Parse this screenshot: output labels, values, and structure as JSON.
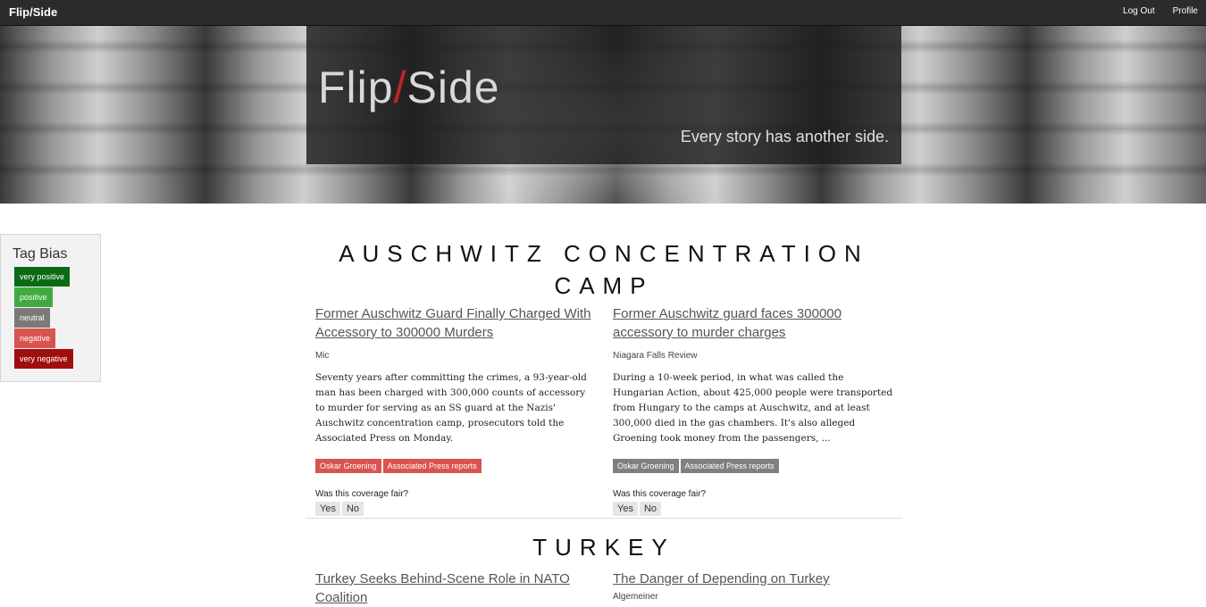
{
  "nav": {
    "brand": "Flip/Side",
    "logout": "Log Out",
    "profile": "Profile"
  },
  "hero": {
    "title_left": "Flip",
    "title_slash": "/",
    "title_right": "Side",
    "tagline": "Every story has another side."
  },
  "tag_bias": {
    "title": "Tag Bias",
    "levels": [
      {
        "label": "very positive",
        "color": "#0b6b14"
      },
      {
        "label": "positive",
        "color": "#3fab3f"
      },
      {
        "label": "neutral",
        "color": "#7a7a7a"
      },
      {
        "label": "negative",
        "color": "#d9534f"
      },
      {
        "label": "very negative",
        "color": "#a00e0e"
      }
    ]
  },
  "sections": [
    {
      "title": "AUSCHWITZ CONCENTRATION CAMP",
      "articles": [
        {
          "title": "Former Auschwitz Guard Finally Charged With Accessory to 300000 Murders",
          "source": "Mic",
          "text": "Seventy years after committing the crimes, a 93-year-old man has been charged with 300,000 counts of accessory to murder for serving as an SS guard at the Nazis' Auschwitz concentration camp, prosecutors told the Associated Press on Monday.",
          "tags": [
            "Oskar Groening",
            "Associated Press reports"
          ],
          "fair_question": "Was this coverage fair?",
          "yes": "Yes",
          "no": "No"
        },
        {
          "title": "Former Auschwitz guard faces 300000 accessory to murder charges",
          "source": "Niagara Falls Review",
          "text": "During a 10-week period, in what was called the Hungarian Action, about 425,000 people were transported from Hungary to the camps at Auschwitz, and at least 300,000 died in the gas chambers. It's also alleged Groening took money from the passengers, ...",
          "tags": [
            "Oskar Groening",
            "Associated Press reports"
          ],
          "fair_question": "Was this coverage fair?",
          "yes": "Yes",
          "no": "No"
        }
      ]
    },
    {
      "title": "TURKEY",
      "articles": [
        {
          "title": "Turkey Seeks Behind-Scene Role in NATO Coalition",
          "source": ""
        },
        {
          "title": "The Danger of Depending on Turkey",
          "source": "Algemeiner"
        }
      ]
    }
  ]
}
